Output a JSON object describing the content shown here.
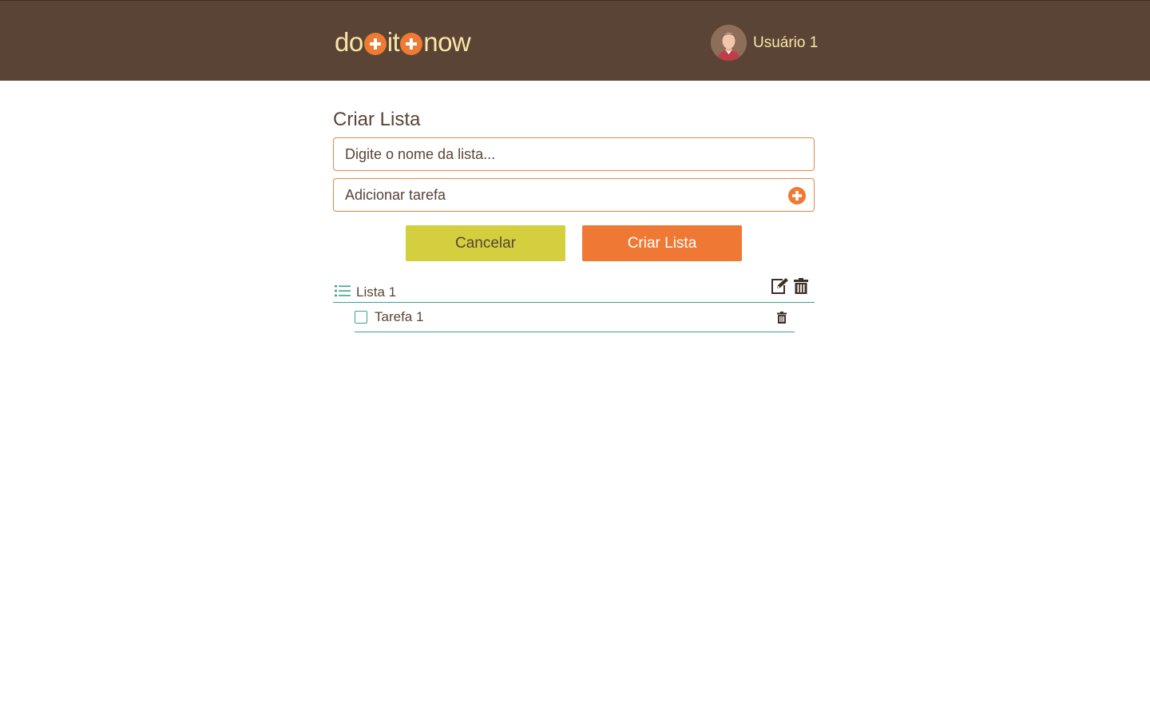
{
  "header": {
    "logo": {
      "part1": "do",
      "part2": "it",
      "part3": "now"
    },
    "user": {
      "name": "Usuário 1"
    }
  },
  "form": {
    "title": "Criar Lista",
    "list_name_placeholder": "Digite o nome da lista...",
    "task_placeholder": "Adicionar tarefa",
    "cancel_label": "Cancelar",
    "create_label": "Criar Lista"
  },
  "lists": [
    {
      "title": "Lista 1",
      "tasks": [
        {
          "title": "Tarefa 1",
          "done": false
        }
      ]
    }
  ],
  "colors": {
    "header_bg": "#5a4436",
    "logo_text": "#f6e7a6",
    "accent_orange": "#ef7834",
    "cancel_yellow": "#d3cf3f",
    "teal": "#3aa58a",
    "text_brown": "#5a4437"
  },
  "icons": {
    "logo_plus": "plus-circle-icon",
    "add_task": "plus-circle-icon",
    "list": "list-icon",
    "edit": "edit-icon",
    "delete": "trash-icon"
  }
}
